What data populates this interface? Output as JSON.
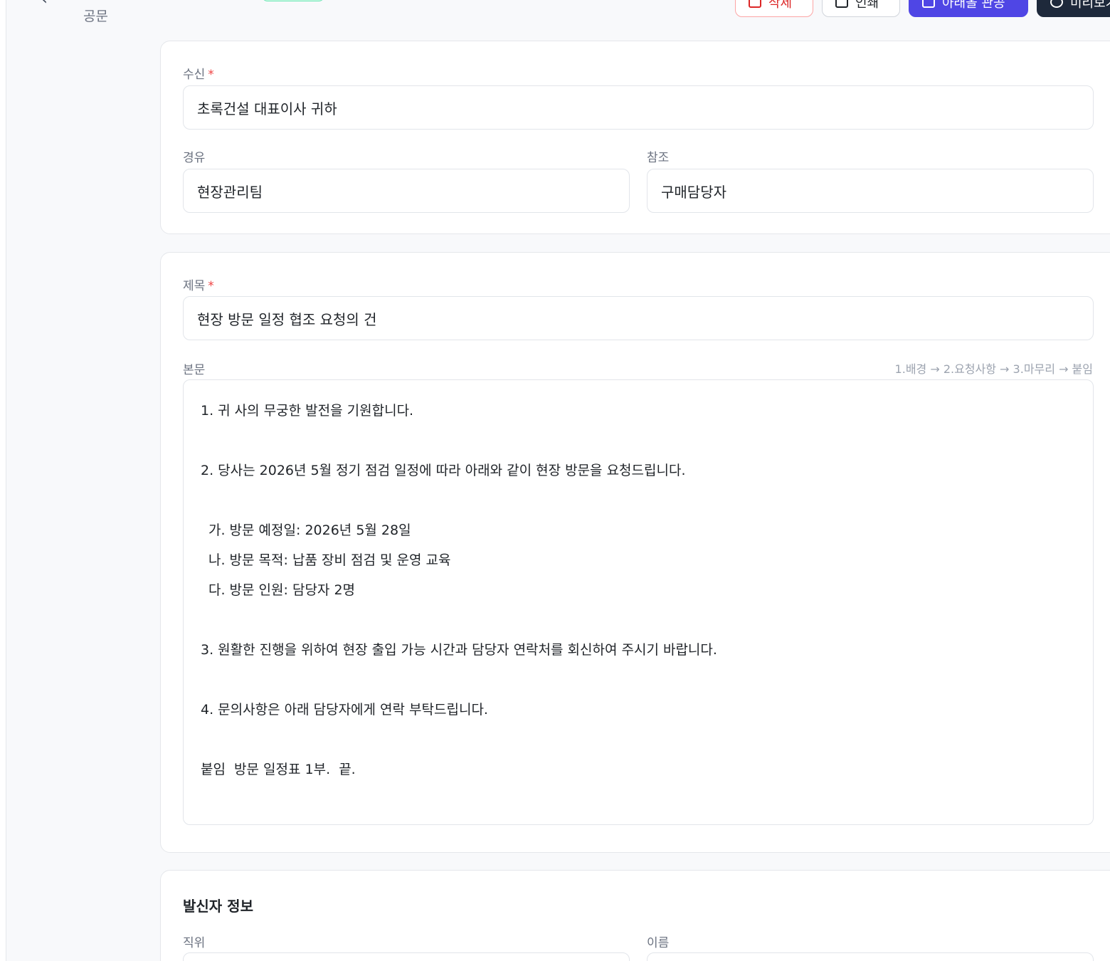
{
  "header": {
    "breadcrumb": "공문",
    "actions": {
      "delete_label": "삭제",
      "print_label": "인쇄",
      "template_label": "아래올 관공",
      "preview_label": "미리보기"
    }
  },
  "recipient_section": {
    "recipient_label": "수신",
    "recipient_value": "초록건설 대표이사 귀하",
    "via_label": "경유",
    "via_value": "현장관리팀",
    "cc_label": "참조",
    "cc_value": "구매담당자"
  },
  "content_section": {
    "title_label": "제목",
    "title_value": "현장 방문 일정 협조 요청의 건",
    "body_label": "본문",
    "structure_hint": "1.배경 → 2.요청사항 → 3.마무리 → 붙임",
    "body_lines": [
      "1. 귀 사의 무궁한 발전을 기원합니다.",
      "",
      "2. 당사는 2026년 5월 정기 점검 일정에 따라 아래와 같이 현장 방문을 요청드립니다.",
      "",
      "가. 방문 예정일: 2026년 5월 28일",
      "나. 방문 목적: 납품 장비 점검 및 운영 교육",
      "다. 방문 인원: 담당자 2명",
      "",
      "3. 원활한 진행을 위하여 현장 출입 가능 시간과 담당자 연락처를 회신하여 주시기 바랍니다.",
      "",
      "4. 문의사항은 아래 담당자에게 연락 부탁드립니다.",
      "",
      "붙임  방문 일정표 1부.  끝."
    ]
  },
  "sender_section": {
    "title": "발신자 정보",
    "position_label": "직위",
    "name_label": "이름"
  },
  "colors": {
    "accent": "#4f46e5",
    "danger": "#dc2626",
    "dark": "#1e293b",
    "required": "#ef4444"
  }
}
